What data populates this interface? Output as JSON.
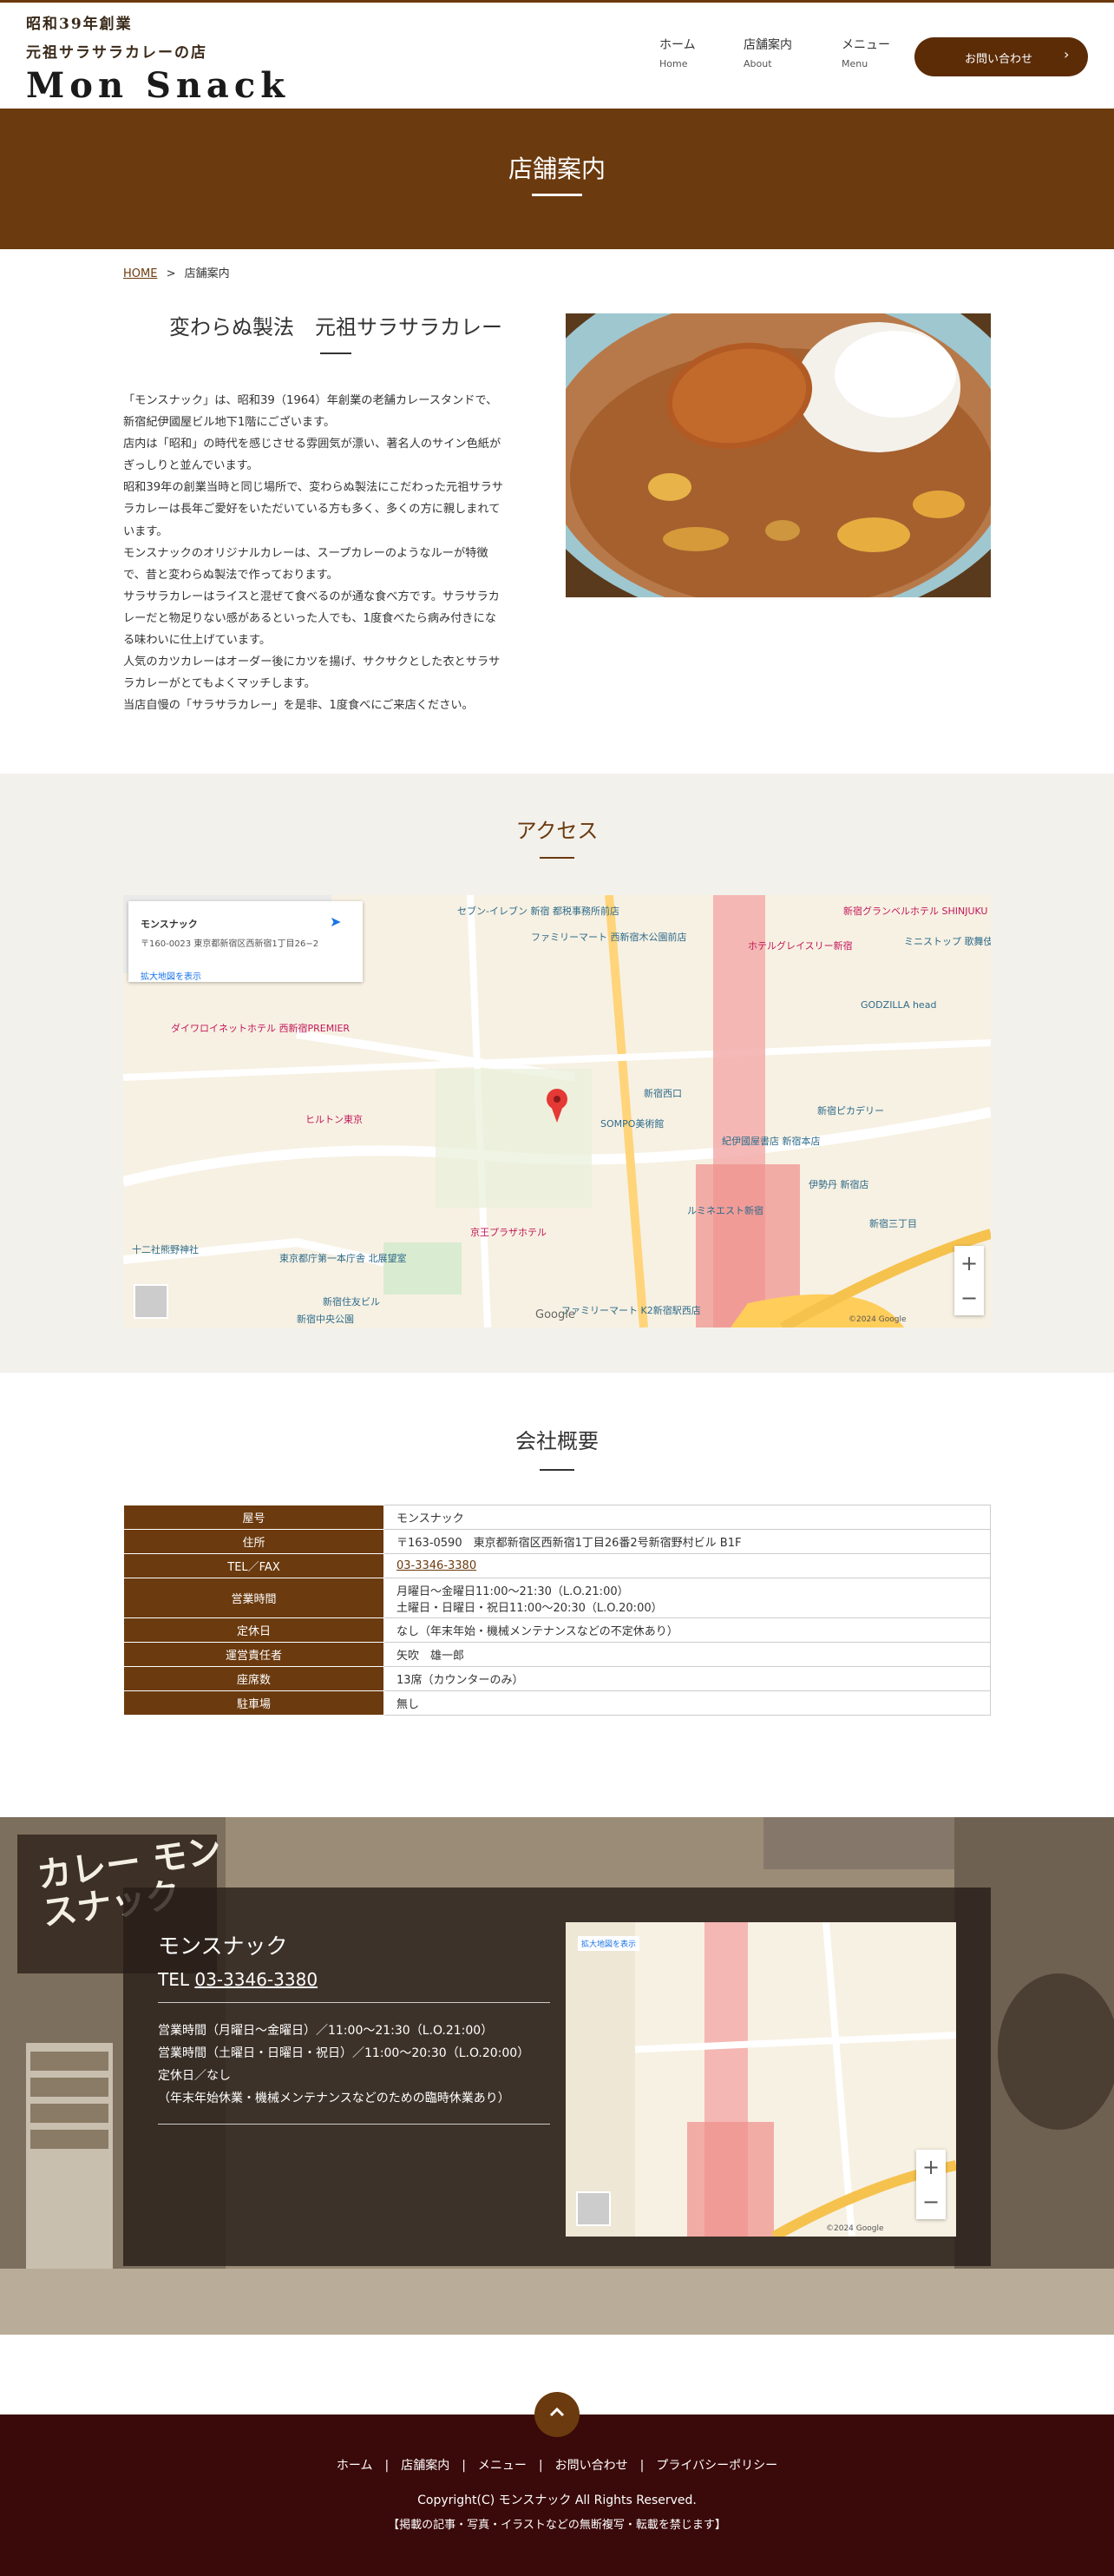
{
  "header": {
    "logo_line1": "昭和39年創業",
    "logo_line2": "元祖サラサラカレーの店",
    "logo_line3": "Mon Snack",
    "nav": [
      {
        "label": "ホーム",
        "sub": "Home"
      },
      {
        "label": "店舗案内",
        "sub": "About"
      },
      {
        "label": "メニュー",
        "sub": "Menu"
      }
    ],
    "contact_label": "お問い合わせ"
  },
  "hero": {
    "title": "店舗案内"
  },
  "breadcrumb": {
    "home": "HOME",
    "sep": ">",
    "current": "店舗案内"
  },
  "intro": {
    "title": "変わらぬ製法　元祖サラサラカレー",
    "lines": [
      "「モンスナック」は、昭和39（1964）年創業の老舗カレースタンドで、",
      "新宿紀伊國屋ビル地下1階にございます。",
      "店内は「昭和」の時代を感じさせる雰囲気が漂い、著名人のサイン色紙が",
      "ぎっしりと並んでいます。",
      "昭和39年の創業当時と同じ場所で、変わらぬ製法にこだわった元祖サラサ",
      "ラカレーは長年ご愛好をいただいている方も多く、多くの方に親しまれて",
      "います。",
      "モンスナックのオリジナルカレーは、スープカレーのようなルーが特徴",
      "で、昔と変わらぬ製法で作っております。",
      "サラサラカレーはライスと混ぜて食べるのが通な食べ方です。サラサラカ",
      "レーだと物足りない感があるといった人でも、1度食べたら病み付きにな",
      "る味わいに仕上げています。",
      "人気のカツカレーはオーダー後にカツを揚げ、サクサクとした衣とサラサ",
      "ラカレーがとてもよくマッチします。",
      "当店自慢の「サラサラカレー」を是非、1度食べにご来店ください。"
    ]
  },
  "access": {
    "title": "アクセス",
    "map_card": {
      "name": "モンスナック",
      "address": "〒160-0023 東京都新宿区西新宿1丁目26−2",
      "link": "拡大地図を表示"
    },
    "map_labels": [
      "セブン-イレブン 新宿 都税事務所前店",
      "ファミリーマート 西新宿木公園前店",
      "ホテルグレイスリー新宿",
      "新宿グランベルホテル SHINJUKU GRANBELL",
      "GODZILLA head",
      "ダイワロイネットホテル 西新宿PREMIER",
      "ヒルトン東京",
      "新宿西口",
      "SOMPO美術館",
      "紀伊國屋書店 新宿本店",
      "新宿ピカデリー",
      "伊勢丹 新宿店",
      "新宿三丁目",
      "ルミネエスト新宿",
      "十二社熊野神社",
      "東京都庁第一本庁舎 北展望室",
      "新宿住友ビル",
      "新宿中央公園",
      "京王プラザホテル",
      "ファミリーマート K2新宿駅西店",
      "ミニストップ 歌舞伎町店"
    ],
    "map_footer": "©2024 Google",
    "google": "Google"
  },
  "company": {
    "title": "会社概要",
    "rows": [
      {
        "k": "屋号",
        "v": [
          "モンスナック"
        ]
      },
      {
        "k": "住所",
        "v": [
          "〒163-0590　東京都新宿区西新宿1丁目26番2号新宿野村ビル B1F"
        ]
      },
      {
        "k": "TEL／FAX",
        "v": [
          "03-3346-3380"
        ],
        "link": true
      },
      {
        "k": "営業時間",
        "v": [
          "月曜日～金曜日11:00～21:30（L.O.21:00）",
          "土曜日・日曜日・祝日11:00～20:30（L.O.20:00）"
        ]
      },
      {
        "k": "定休日",
        "v": [
          "なし（年末年始・機械メンテナンスなどの不定休あり）"
        ]
      },
      {
        "k": "運営責任者",
        "v": [
          "矢吹　雄一郎"
        ]
      },
      {
        "k": "座席数",
        "v": [
          "13席（カウンターのみ）"
        ]
      },
      {
        "k": "駐車場",
        "v": [
          "無し"
        ]
      }
    ]
  },
  "info_panel": {
    "name": "モンスナック",
    "tel_label": "TEL",
    "tel": "03-3346-3380",
    "hours": [
      "営業時間（月曜日～金曜日）／11:00～21:30（L.O.21:00）",
      "営業時間（土曜日・日曜日・祝日）／11:00～20:30（L.O.20:00）",
      "定休日／なし",
      "（年末年始休業・機械メンテナンスなどのための臨時休業あり）"
    ],
    "photo_text": "カレー モンスナック",
    "map_link": "拡大地図を表示",
    "map_footer": "©2024 Google"
  },
  "footer": {
    "nav": [
      "ホーム",
      "店舗案内",
      "メニュー",
      "お問い合わせ",
      "プライバシーポリシー"
    ],
    "copyright": "Copyright(C) モンスナック All Rights Reserved.",
    "notice": "【掲載の記事・写真・イラストなどの無断複写・転載を禁じます】"
  }
}
